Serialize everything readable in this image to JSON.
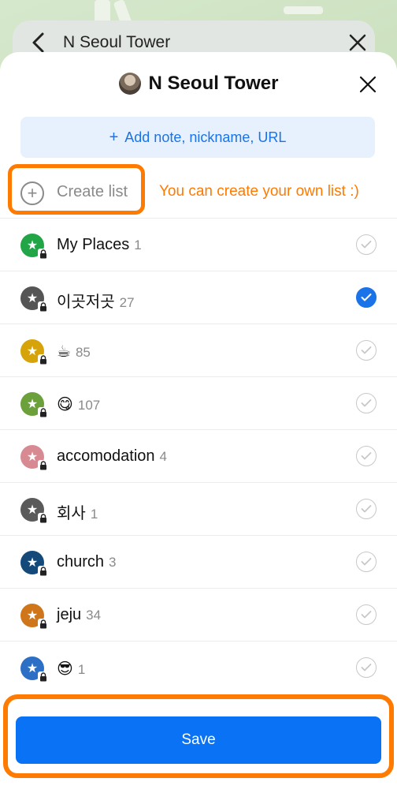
{
  "search": {
    "text": "N Seoul Tower"
  },
  "sheet": {
    "title": "N Seoul Tower",
    "add_note_plus": "+",
    "add_note_label": "Add note, nickname, URL",
    "create_plus": "+",
    "create_label": "Create list",
    "annotation": "You can create your own list :)"
  },
  "lists": [
    {
      "label": "My Places",
      "count": "1",
      "color": "#22a546",
      "checked": false
    },
    {
      "label": "이곳저곳",
      "count": "27",
      "color": "#555555",
      "checked": true
    },
    {
      "label": "☕",
      "count": "85",
      "color": "#d6a40a",
      "checked": false
    },
    {
      "label": "😋",
      "count": "107",
      "color": "#6ba03a",
      "checked": false
    },
    {
      "label": "accomodation",
      "count": "4",
      "color": "#d88a93",
      "checked": false
    },
    {
      "label": "회사",
      "count": "1",
      "color": "#5a5a5a",
      "checked": false
    },
    {
      "label": "church",
      "count": "3",
      "color": "#134a7a",
      "checked": false
    },
    {
      "label": "jeju",
      "count": "34",
      "color": "#d0761a",
      "checked": false
    },
    {
      "label": "😎",
      "count": "1",
      "color": "#2d6fc4",
      "checked": false
    }
  ],
  "save_label": "Save",
  "colors": {
    "accent": "#1a73e8",
    "highlight": "#ff7a00",
    "save": "#0a73f5"
  }
}
